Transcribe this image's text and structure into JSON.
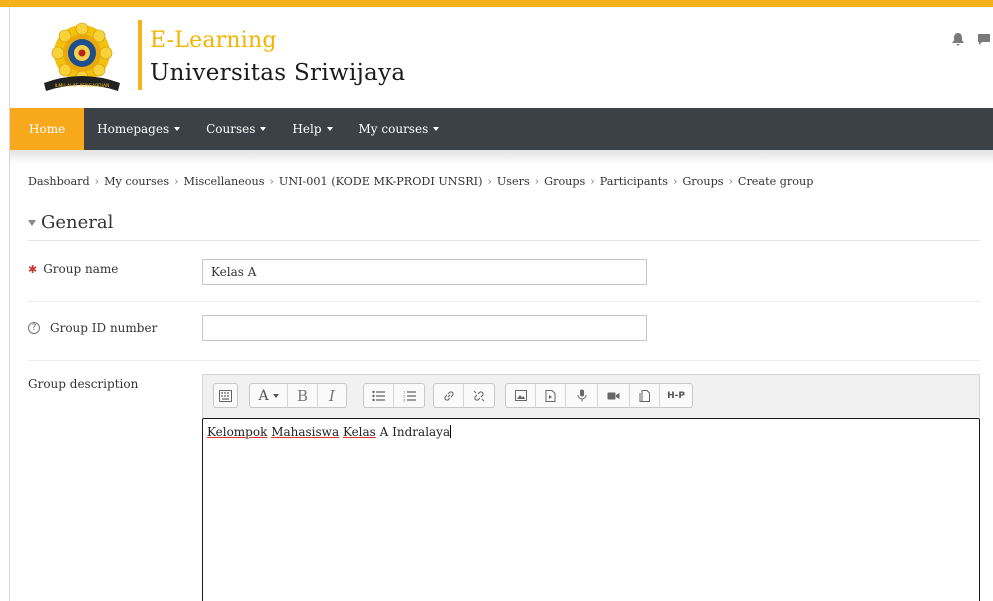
{
  "header": {
    "brand_line1": "E-Learning",
    "brand_line2": "Universitas Sriwijaya",
    "logo_text": "ILMU ALAT PENGABDIAN",
    "icons": [
      "bell-icon",
      "chat-icon"
    ]
  },
  "nav": {
    "items": [
      {
        "label": "Home",
        "active": true
      },
      {
        "label": "Homepages",
        "dropdown": true
      },
      {
        "label": "Courses",
        "dropdown": true
      },
      {
        "label": "Help",
        "dropdown": true
      },
      {
        "label": "My courses",
        "dropdown": true
      }
    ]
  },
  "breadcrumb": [
    "Dashboard",
    "My courses",
    "Miscellaneous",
    "UNI-001 (KODE MK-PRODI UNSRI)",
    "Users",
    "Groups",
    "Participants",
    "Groups",
    "Create group"
  ],
  "section": {
    "title": "General"
  },
  "form": {
    "group_name_label": "Group name",
    "group_name_value": "Kelas A",
    "group_id_label": "Group ID number",
    "group_id_value": "",
    "group_desc_label": "Group description",
    "description": {
      "w1": "Kelompok",
      "w2": "Mahasiswa",
      "w3": "Kelas",
      "w4": "A Indralaya"
    }
  },
  "toolbar": {
    "font_label": "A",
    "bold_label": "B",
    "italic_label": "I",
    "h5p_label": "H-P"
  },
  "colors": {
    "accent": "#f7a81b",
    "navbar": "#3b4144",
    "brand_yellow": "#f1b400",
    "required": "#c8372d"
  }
}
